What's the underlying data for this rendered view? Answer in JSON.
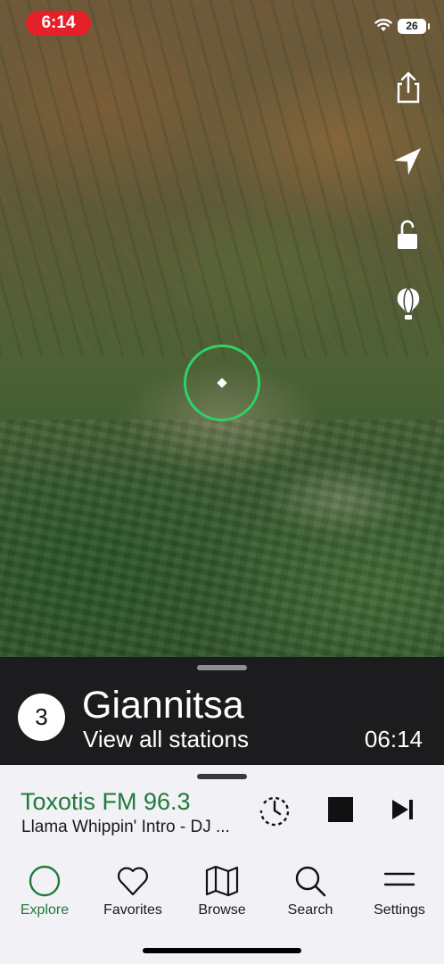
{
  "status_bar": {
    "time": "6:14",
    "battery": "26",
    "wifi_icon": "wifi-icon"
  },
  "map_controls": [
    {
      "name": "share-button",
      "icon": "share-icon"
    },
    {
      "name": "locate-button",
      "icon": "location-arrow-icon"
    },
    {
      "name": "lock-button",
      "icon": "unlock-icon"
    },
    {
      "name": "tips-button",
      "icon": "hot-air-balloon-icon"
    }
  ],
  "location": {
    "station_count": "3",
    "name": "Giannitsa",
    "link": "View all stations",
    "local_time": "06:14"
  },
  "now_playing": {
    "station": "Toxotis FM 96.3",
    "track": "Llama Whippin' Intro - DJ ...",
    "controls": [
      "sleep-timer-icon",
      "stop-icon",
      "skip-next-icon"
    ]
  },
  "tabs": [
    {
      "label": "Explore",
      "icon": "explore-circle-icon",
      "active": true
    },
    {
      "label": "Favorites",
      "icon": "heart-icon",
      "active": false
    },
    {
      "label": "Browse",
      "icon": "map-icon",
      "active": false
    },
    {
      "label": "Search",
      "icon": "search-icon",
      "active": false
    },
    {
      "label": "Settings",
      "icon": "menu-lines-icon",
      "active": false
    }
  ],
  "colors": {
    "accent": "#1f7a3a",
    "radar_ring": "#2fd167",
    "time_pill": "#e5202a",
    "panel_dark": "#1c1c1e",
    "player_bg": "#f2f2f6"
  }
}
